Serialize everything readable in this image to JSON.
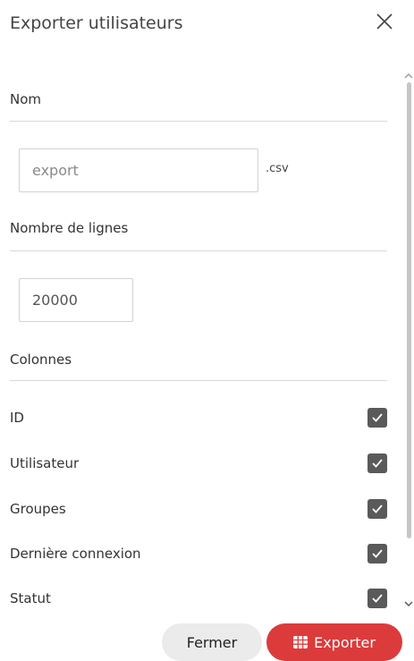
{
  "dialog": {
    "title": "Exporter utilisateurs"
  },
  "name_section": {
    "label": "Nom",
    "placeholder": "export",
    "suffix": ".csv"
  },
  "rows_section": {
    "label": "Nombre de lignes",
    "value": "20000"
  },
  "columns_section": {
    "label": "Colonnes",
    "items": [
      {
        "label": "ID",
        "checked": true
      },
      {
        "label": "Utilisateur",
        "checked": true
      },
      {
        "label": "Groupes",
        "checked": true
      },
      {
        "label": "Dernière connexion",
        "checked": true
      },
      {
        "label": "Statut",
        "checked": true
      }
    ]
  },
  "footer": {
    "close_label": "Fermer",
    "export_label": "Exporter"
  },
  "colors": {
    "accent": "#dc3b3b",
    "checkbox": "#5a5a5a",
    "divider": "#d9d9d9"
  },
  "icons": {
    "close": "close-icon",
    "export": "table-grid-icon",
    "check": "checkmark-icon"
  }
}
